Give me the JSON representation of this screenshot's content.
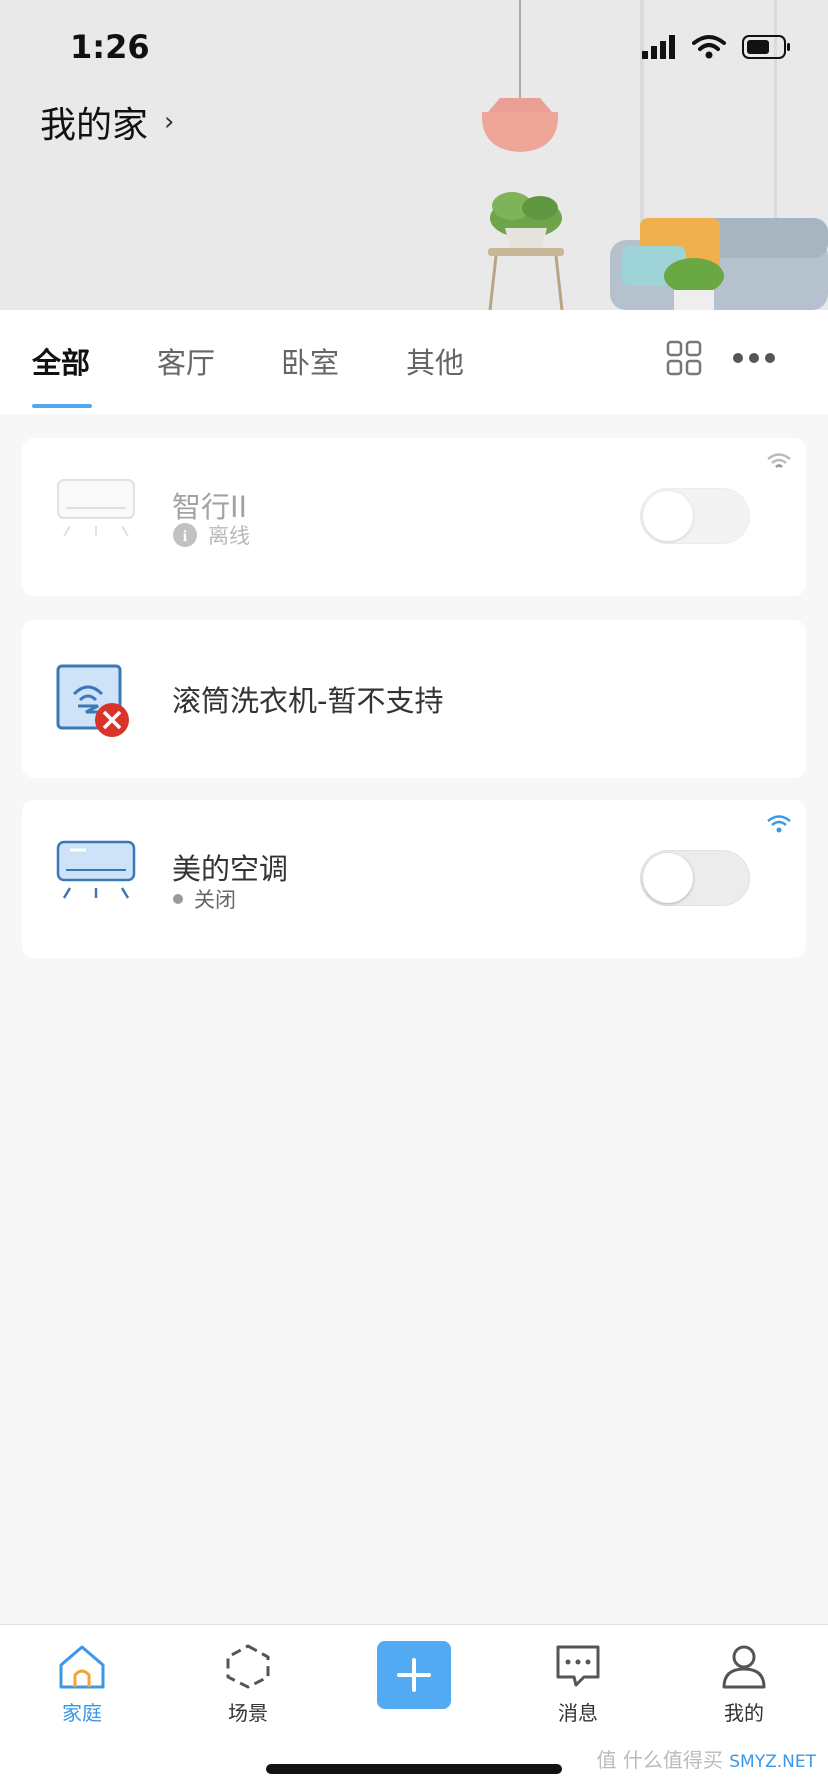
{
  "status_bar": {
    "time": "1:26"
  },
  "header": {
    "home_name": "我的家",
    "chevron": "›"
  },
  "tabs": [
    {
      "label": "全部",
      "active": true
    },
    {
      "label": "客厅",
      "active": false
    },
    {
      "label": "卧室",
      "active": false
    },
    {
      "label": "其他",
      "active": false
    }
  ],
  "devices": [
    {
      "name": "智行II",
      "status": "离线",
      "state": "offline",
      "has_toggle": true,
      "toggle_on": false,
      "icon": "air-conditioner-icon"
    },
    {
      "name": "滚筒洗衣机-暂不支持",
      "status": "",
      "state": "unsupported",
      "has_toggle": false,
      "icon": "unsupported-device-icon"
    },
    {
      "name": "美的空调",
      "status": "关闭",
      "state": "off",
      "has_toggle": true,
      "toggle_on": false,
      "icon": "air-conditioner-icon"
    }
  ],
  "bottom_nav": [
    {
      "label": "家庭",
      "icon": "home-icon",
      "active": true
    },
    {
      "label": "场景",
      "icon": "scene-icon",
      "active": false
    },
    {
      "label": "",
      "icon": "plus-icon",
      "active": false
    },
    {
      "label": "消息",
      "icon": "message-icon",
      "active": false
    },
    {
      "label": "我的",
      "icon": "user-icon",
      "active": false
    }
  ],
  "watermark": {
    "text": "值 什么值得买",
    "url": "SMYZ.NET"
  },
  "colors": {
    "accent": "#4ea8f2",
    "nav_active": "#3b97e8",
    "error": "#d9342b"
  }
}
